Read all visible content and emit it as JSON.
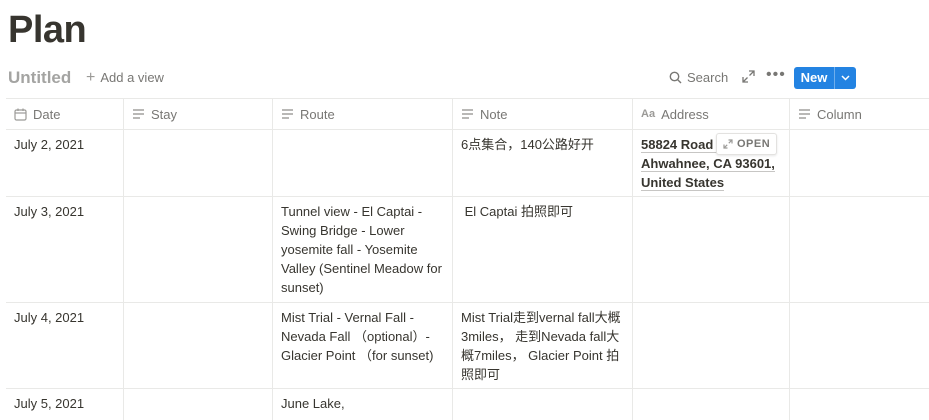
{
  "page": {
    "title": "Plan"
  },
  "view_bar": {
    "view_name": "Untitled",
    "add_view": "Add a view",
    "search": "Search",
    "new_button": "New"
  },
  "columns": [
    {
      "label": "Date",
      "icon": "calendar-icon"
    },
    {
      "label": "Stay",
      "icon": "text-lines-icon"
    },
    {
      "label": "Route",
      "icon": "text-lines-icon"
    },
    {
      "label": "Note",
      "icon": "text-lines-icon"
    },
    {
      "label": "Address",
      "icon": "title-aa-icon"
    },
    {
      "label": "Column",
      "icon": "text-lines-icon"
    }
  ],
  "rows": [
    {
      "date": "July 2, 2021",
      "stay": "",
      "route": "",
      "note": "6点集合，140公路好开",
      "address": [
        "58824 Road 6",
        "Ahwahnee, CA 93601,",
        "United States"
      ],
      "column": ""
    },
    {
      "date": "July 3, 2021",
      "stay": "",
      "route": "Tunnel view - El Captai - Swing Bridge - Lower yosemite fall - Yosemite Valley (Sentinel Meadow for sunset)",
      "note": " El Captai 拍照即可",
      "address": [],
      "column": ""
    },
    {
      "date": "July 4, 2021",
      "stay": "",
      "route": "Mist Trial - Vernal Fall - Nevada Fall （optional）- Glacier Point （for sunset)",
      "note": "Mist Trial走到vernal fall大概3miles， 走到Nevada fall大概7miles， Glacier Point 拍照即可",
      "address": [],
      "column": ""
    },
    {
      "date": "July 5, 2021",
      "stay": "",
      "route": "June Lake,",
      "note": "",
      "address": [],
      "column": ""
    }
  ],
  "open_button": "OPEN",
  "colors": {
    "accent": "#2383e2",
    "text": "#37352f",
    "muted": "#787774",
    "border": "#e9e9e7"
  }
}
